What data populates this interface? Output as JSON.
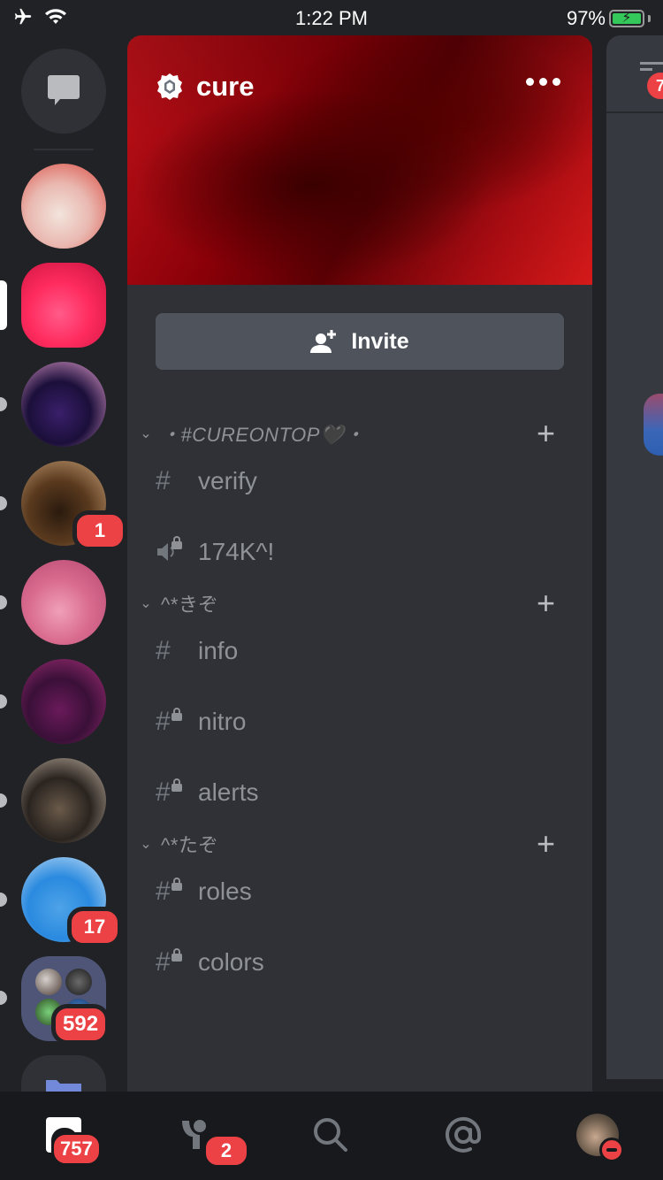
{
  "status_bar": {
    "time": "1:22 PM",
    "battery": "97%",
    "icons": [
      "airplane-icon",
      "wifi-icon",
      "battery-charging-icon"
    ]
  },
  "server_rail": {
    "dm_icon": "chat-bubble-icon",
    "servers": [
      {
        "name": "server-1",
        "colors": [
          "#e9b8b0",
          "#d9453b",
          "#f2e4dc"
        ],
        "shape": "circle",
        "indicator": "none",
        "badge": null
      },
      {
        "name": "server-2-selected",
        "colors": [
          "#ff2b5e",
          "#c8143f",
          "#ff5b8a"
        ],
        "shape": "rounded",
        "indicator": "selected",
        "badge": null
      },
      {
        "name": "server-3",
        "colors": [
          "#1b0f3a",
          "#f2a8d8",
          "#3a1f6a"
        ],
        "shape": "circle",
        "indicator": "unread",
        "badge": null
      },
      {
        "name": "server-4",
        "colors": [
          "#5a3a1e",
          "#c9a27a",
          "#2a1a0e"
        ],
        "shape": "circle",
        "indicator": "unread",
        "badge": "1"
      },
      {
        "name": "server-5",
        "colors": [
          "#d96b8f",
          "#b54770",
          "#f0a0b8"
        ],
        "shape": "circle",
        "indicator": "unread",
        "badge": null
      },
      {
        "name": "server-6",
        "colors": [
          "#3a1038",
          "#a8307a",
          "#6a1a5a"
        ],
        "shape": "circle",
        "indicator": "unread",
        "badge": null
      },
      {
        "name": "server-7",
        "colors": [
          "#2a2420",
          "#c8b8a8",
          "#6a5a4a"
        ],
        "shape": "circle",
        "indicator": "unread",
        "badge": null
      },
      {
        "name": "server-8",
        "colors": [
          "#2a8adf",
          "#cfe4f7",
          "#4ea3e8"
        ],
        "shape": "circle",
        "indicator": "unread",
        "badge": "17"
      }
    ],
    "folder": {
      "indicator": "unread",
      "badge": "592",
      "color": "#4e5577"
    }
  },
  "channel_panel": {
    "server_name": "cure",
    "server_badge_icon": "server-boost-badge-icon",
    "more_icon": "more-dots-icon",
    "invite_label": "Invite",
    "categories": [
      {
        "name": "・#CUREONTOP🖤・",
        "italic": true,
        "channels": [
          {
            "name": "verify",
            "type": "text",
            "locked": false
          },
          {
            "name": "174K^!",
            "type": "voice",
            "locked": true
          }
        ]
      },
      {
        "name": "^*きぞ",
        "italic": false,
        "channels": [
          {
            "name": "info",
            "type": "text",
            "locked": false
          },
          {
            "name": "nitro",
            "type": "text",
            "locked": true
          },
          {
            "name": "alerts",
            "type": "text",
            "locked": true
          }
        ]
      },
      {
        "name": "^*たぞ",
        "italic": false,
        "channels": [
          {
            "name": "roles",
            "type": "text",
            "locked": true
          },
          {
            "name": "colors",
            "type": "text",
            "locked": true
          }
        ]
      }
    ]
  },
  "peek_panel": {
    "badge": "7"
  },
  "bottom_nav": {
    "items": [
      {
        "name": "home",
        "badge": "757"
      },
      {
        "name": "friends",
        "badge": "2"
      },
      {
        "name": "search",
        "badge": null
      },
      {
        "name": "mentions",
        "badge": null
      },
      {
        "name": "profile",
        "badge": null,
        "status": "dnd"
      }
    ]
  },
  "colors": {
    "badge_red": "#ed4245",
    "panel_bg": "#2f3136",
    "rail_bg": "#202225",
    "nav_bg": "#18191c",
    "invite_bg": "#4f545c"
  }
}
